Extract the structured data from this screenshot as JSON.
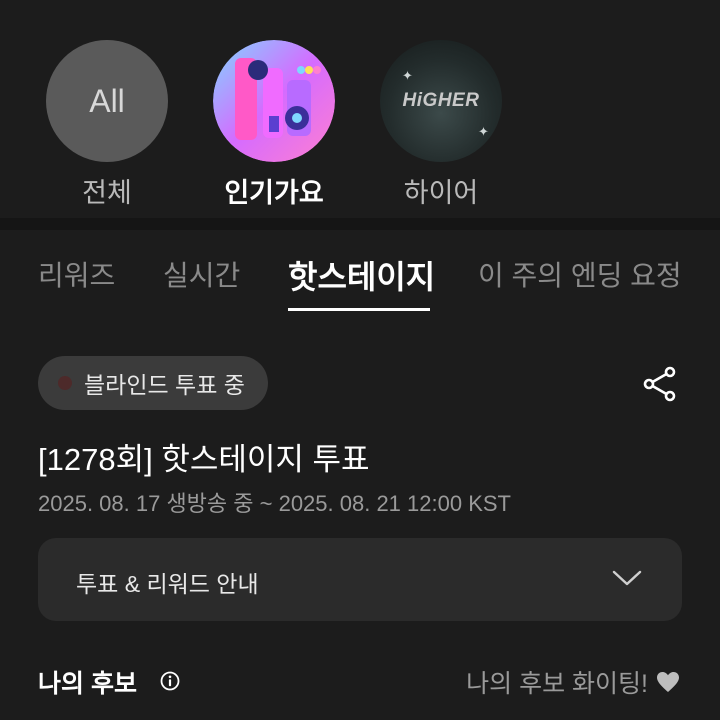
{
  "programs": [
    {
      "id": "all",
      "circle_text": "All",
      "label": "전체",
      "active": false
    },
    {
      "id": "inkigayo",
      "circle_text": "",
      "label": "인기가요",
      "active": true
    },
    {
      "id": "higher",
      "circle_text": "HiGHER",
      "label": "하이어",
      "active": false
    }
  ],
  "tabs": [
    "리워즈",
    "실시간",
    "핫스테이지",
    "이 주의 엔딩 요정"
  ],
  "active_tab": "핫스테이지",
  "status_chip": "블라인드 투표 중",
  "vote": {
    "title": "[1278회] 핫스테이지 투표",
    "period": "2025. 08. 17 생방송 중 ~ 2025. 08. 21 12:00 KST"
  },
  "accordion_label": "투표 & 리워드 안내",
  "my_candidate": {
    "heading": "나의 후보",
    "cheer": "나의 후보 화이팅!"
  },
  "icons": {
    "share": "share-icon",
    "chevron": "chevron-down-icon",
    "info": "info-icon",
    "heart": "heart-icon"
  },
  "colors": {
    "background": "#1c1c1c",
    "chip": "#3b3b3b",
    "card": "#2b2b2b",
    "muted_text": "#9a9a9a"
  }
}
